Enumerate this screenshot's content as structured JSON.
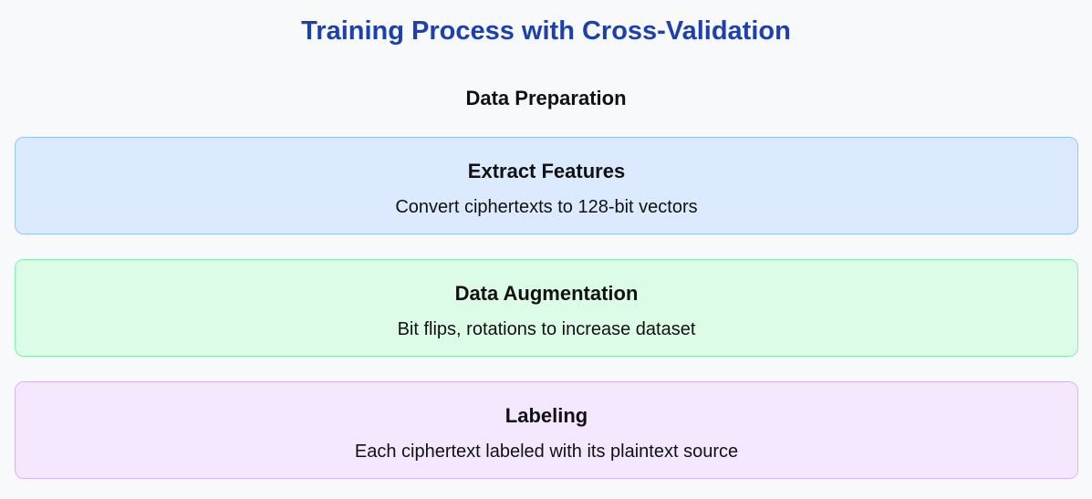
{
  "title": "Training Process with Cross-Validation",
  "section_title": "Data Preparation",
  "steps": [
    {
      "heading": "Extract Features",
      "description": "Convert ciphertexts to 128-bit vectors",
      "fill": "#dbeafe",
      "border": "#93c5fd"
    },
    {
      "heading": "Data Augmentation",
      "description": "Bit flips, rotations to increase dataset",
      "fill": "#dcfce7",
      "border": "#86efac"
    },
    {
      "heading": "Labeling",
      "description": "Each ciphertext labeled with its plaintext source",
      "fill": "#f3e8ff",
      "border": "#d8b4fe"
    }
  ],
  "colors": {
    "title": "#1e40af",
    "background": "#f8f9fb",
    "text": "#111111"
  }
}
